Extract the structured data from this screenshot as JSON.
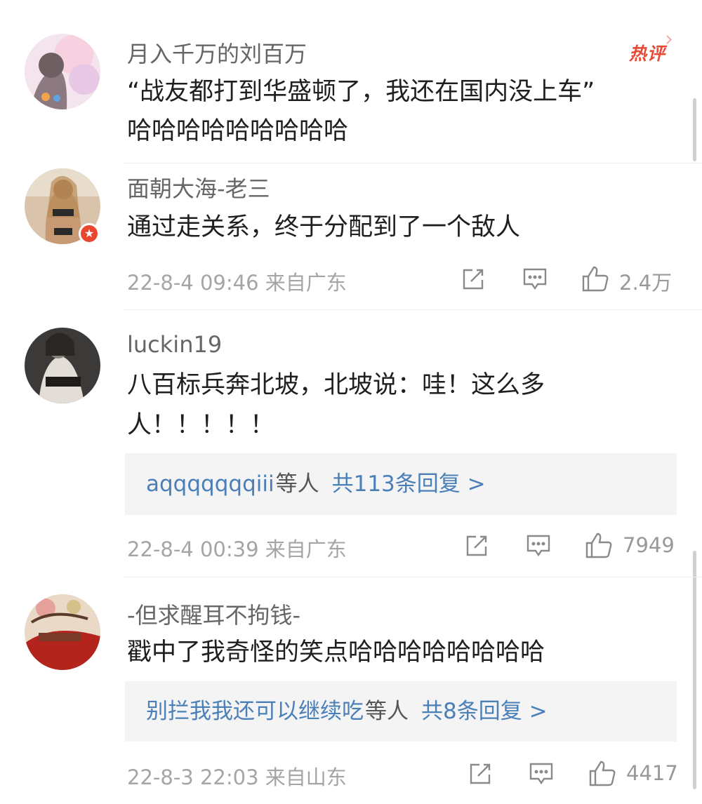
{
  "comments": [
    {
      "username": "月入千万的刘百万",
      "hot_label": "热评",
      "lines": [
        "“战友都打到华盛顿了，我还在国内没上车”",
        "哈哈哈哈哈哈哈哈哈"
      ]
    },
    {
      "username": "面朝大海-老三",
      "badge_icon": "verified-star-icon",
      "lines": [
        "通过走关系，终于分配到了一个敌人"
      ],
      "time": "22-8-4 09:46",
      "location": "来自广东",
      "likes": "2.4万"
    },
    {
      "username": "luckin19",
      "lines": [
        "八百标兵奔北坡，北坡说：哇！这么多",
        "人！！！！！"
      ],
      "reply": {
        "who": "aqqqqqqqiii",
        "etc": "等人",
        "count": "共113条回复 >"
      },
      "time": "22-8-4 00:39",
      "location": "来自广东",
      "likes": "7949"
    },
    {
      "username": "-但求醒耳不拘钱-",
      "lines": [
        "戳中了我奇怪的笑点哈哈哈哈哈哈哈哈"
      ],
      "reply": {
        "who": "别拦我我还可以继续吃",
        "etc": "等人",
        "count": "共8条回复 >"
      },
      "time": "22-8-3 22:03",
      "location": "来自山东",
      "likes": "4417"
    }
  ],
  "icons": {
    "share": "share-icon",
    "comment": "comment-icon",
    "like": "like-icon"
  },
  "colors": {
    "link": "#4a7fb8",
    "hot": "#e94a38",
    "meta": "#a5a5a5",
    "reply_bg": "#f4f4f4"
  }
}
